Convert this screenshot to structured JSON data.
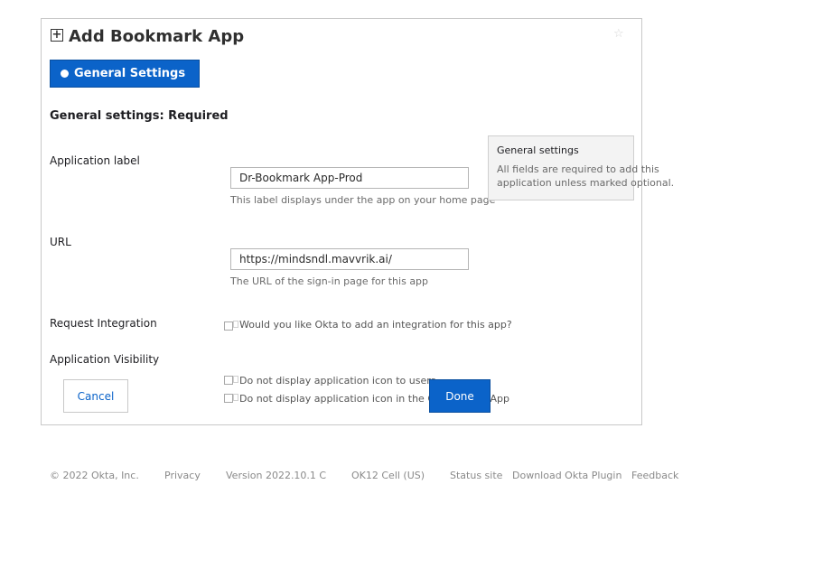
{
  "dialog": {
    "title": "Add Bookmark App",
    "tab_label": "General Settings",
    "section_title": "General settings: Required"
  },
  "fields": {
    "app_label": {
      "label": "Application label",
      "value": "Dr-Bookmark App-Prod",
      "hint": "This label displays under the app on your home page"
    },
    "url": {
      "label": "URL",
      "value": "https://mindsndl.mavvrik.ai/",
      "hint": "The URL of the sign-in page for this app"
    },
    "request_integration": {
      "label": "Request Integration",
      "option": "Would you like Okta to add an integration for this app?",
      "checked": false
    },
    "visibility": {
      "label": "Application Visibility",
      "option1": "Do not display application icon to users",
      "option2": "Do not display application icon in the Okta Mobile App",
      "option1_checked": false,
      "option2_checked": false
    }
  },
  "helpbox": {
    "title": "General settings",
    "body": "All fields are required to add this application unless marked optional."
  },
  "buttons": {
    "cancel": "Cancel",
    "done": "Done"
  },
  "footer": {
    "copyright": "© 2022 Okta, Inc.",
    "privacy": "Privacy",
    "version": "Version 2022.10.1 C",
    "cell": "OK12 Cell (US)",
    "status": "Status site",
    "plugin": "Download Okta Plugin",
    "feedback": "Feedback"
  },
  "colors": {
    "accent": "#0b63c9",
    "border": "#c8c8c8",
    "helpbox_bg": "#f3f3f3"
  },
  "icons": {
    "title": "plus-square-icon",
    "favorite": "star-icon"
  }
}
